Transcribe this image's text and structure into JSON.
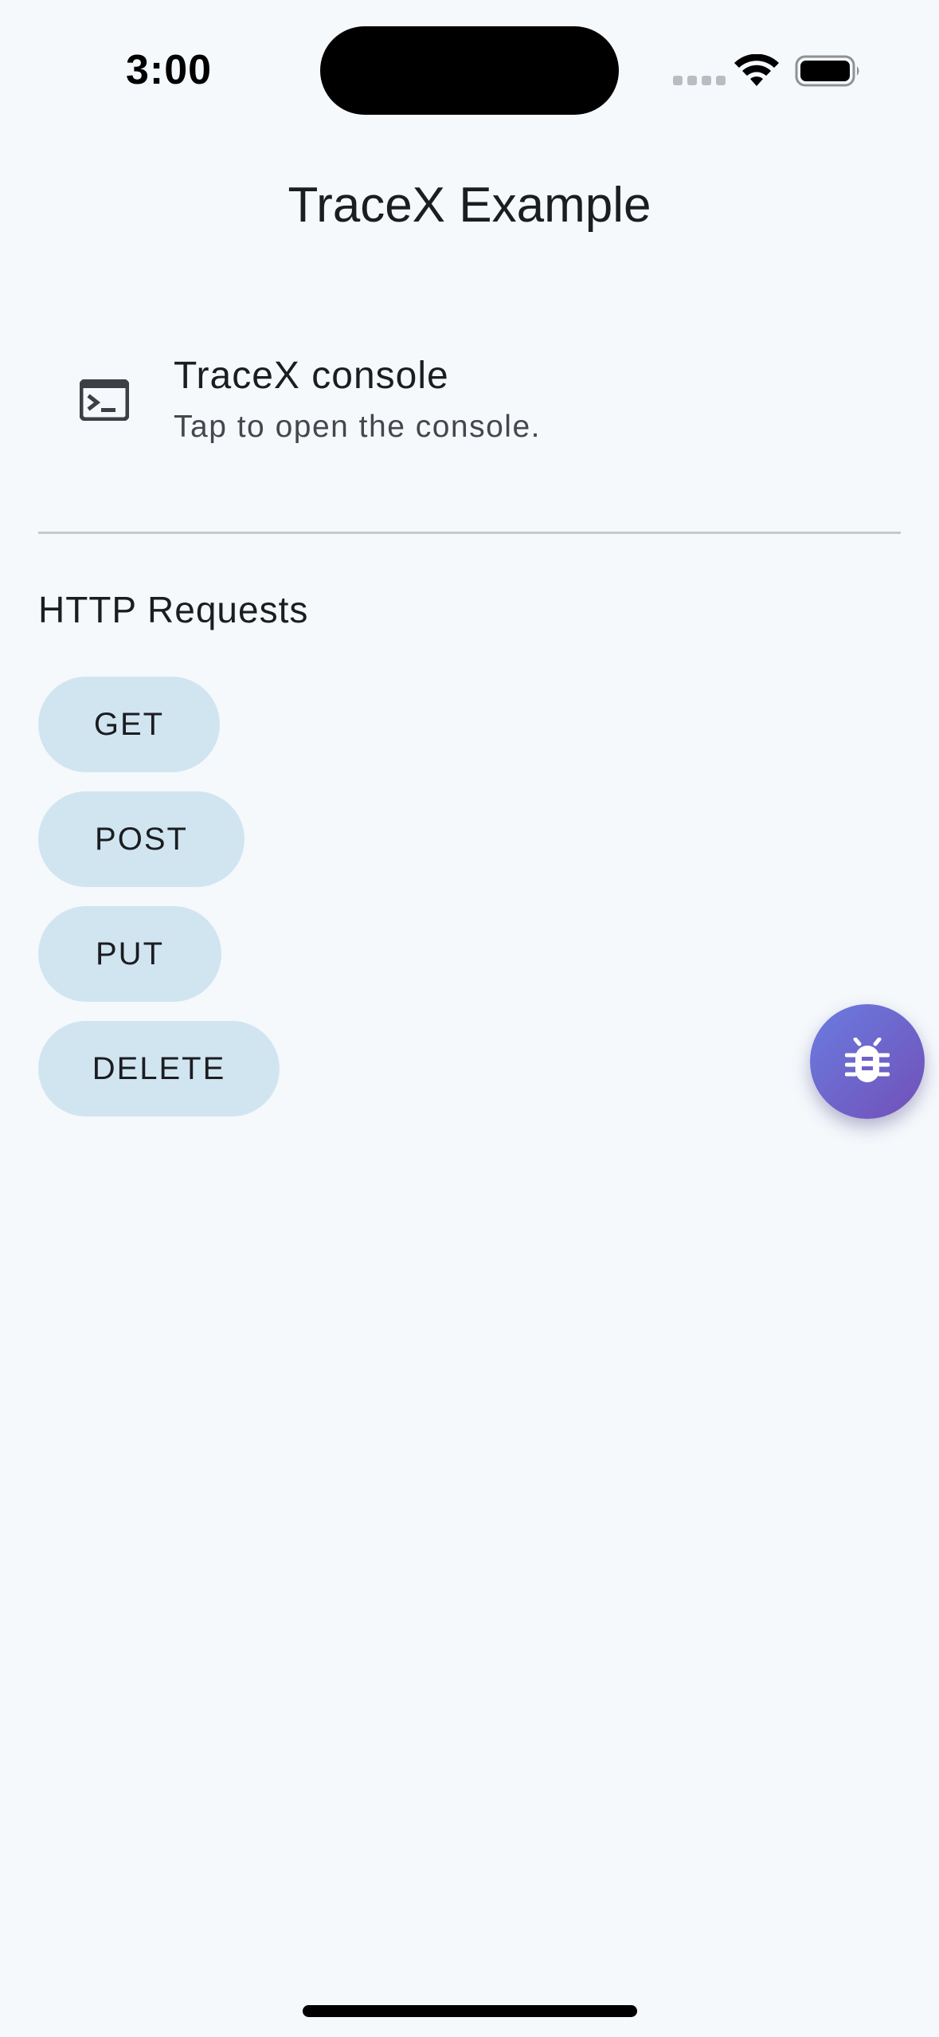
{
  "status_bar": {
    "time": "3:00"
  },
  "app_bar": {
    "title": "TraceX Example"
  },
  "console_tile": {
    "icon": "terminal-icon",
    "title": "TraceX console",
    "subtitle": "Tap to open the console."
  },
  "http_section": {
    "title": "HTTP Requests",
    "buttons": [
      "GET",
      "POST",
      "PUT",
      "DELETE"
    ]
  },
  "fab": {
    "icon": "bug-icon",
    "gradient": [
      "#6b7ce0",
      "#7150b8"
    ]
  },
  "colors": {
    "background": "#f5f9fc",
    "button_bg": "#d1e5f1",
    "divider": "#c5c8cc"
  }
}
